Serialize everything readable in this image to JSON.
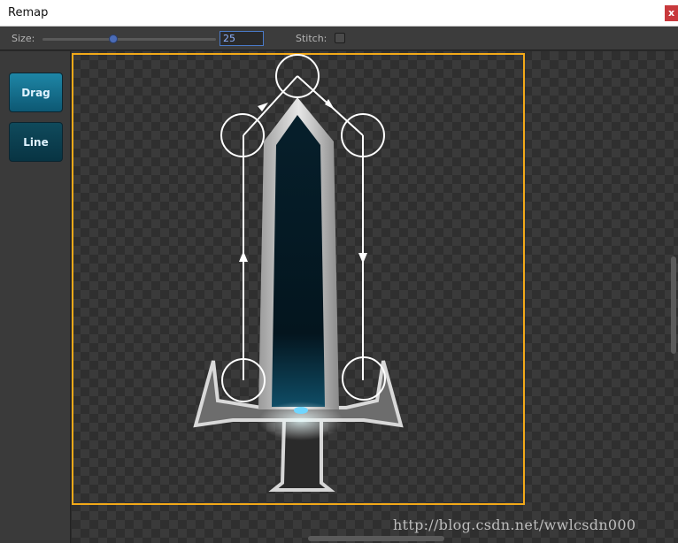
{
  "window": {
    "title": "Remap",
    "close_label": "x"
  },
  "toolbar": {
    "size_label": "Size:",
    "size_value": "25",
    "slider_value_fraction": 0.38,
    "stitch_label": "Stitch:",
    "stitch_checked": false
  },
  "tools": {
    "drag_label": "Drag",
    "line_label": "Line"
  },
  "watermark": "http://blog.csdn.net/wwlcsdn000",
  "colors": {
    "selection_border": "#f3a918",
    "drag_button": "#1a7fa0",
    "line_button": "#0d4557",
    "stroke": "#ffffff",
    "gem": "#6fd6ff"
  }
}
